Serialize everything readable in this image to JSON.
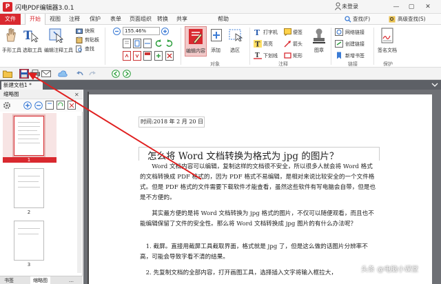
{
  "titlebar": {
    "app_title": "闪电PDF编辑器3.0.1",
    "login": "未登录",
    "logo": "P",
    "min": "—",
    "max": "▢",
    "close": "✕"
  },
  "menu": {
    "items": [
      "文件",
      "开始",
      "视图",
      "注释",
      "保护",
      "表单",
      "页面组织",
      "转换",
      "共享",
      "帮助"
    ],
    "search_left": "查找(F)",
    "search_right": "高级查找(S)"
  },
  "ribbon": {
    "hand_tool": "手形工具",
    "select_tool": "选取工具",
    "edit_annot_tool": "编辑注释工具",
    "snapshot": "快照",
    "clipboard": "剪贴板",
    "find": "查找",
    "zoom_value": "155.46%",
    "edit_content": "编辑内容",
    "add": "添加",
    "select_area": "选区",
    "group_object": "对象",
    "typewriter": "打字机",
    "highlight": "高亮",
    "underline": "下划线",
    "note": "便签",
    "arrow": "箭头",
    "rectangle": "矩形",
    "group_annot": "注释",
    "stamp": "图章",
    "web_link": "网络链接",
    "create_link": "创建链接",
    "new_bookmark": "新增书签",
    "group_link": "链接",
    "sign_doc": "签名文档",
    "group_protect": "保护"
  },
  "tabbar": {
    "doc_tab": "新建文档1 *"
  },
  "thumbs": {
    "header": "缩略图",
    "pages": [
      "1",
      "2",
      "3"
    ]
  },
  "bottom_tabs": [
    "书签",
    "缩略图",
    "…"
  ],
  "doc": {
    "time": "时间:2018 年 2 月 20 日",
    "heading": "怎么将 Word 文档转换为格式为 jpg 的图片？",
    "p1": "Word 文档内容可以编辑，复制这样的文档很不安全，所以很多人就会将 Word 格式的文档转换成 PDF 格式的，因为 PDF 格式不易编辑，是相对来说比较安全的一个文件格式。但是 PDF 格式的文件需要下载软件才能查看，虽然这些软件有写电脑会自带，但是也是不方便的。",
    "p2": "其实最方便的是将 Word 文档转换为 jpg 格式的图片，不仅可以随便观看，而且也不能编辑保留了文件的安全性。那么将 Word 文档转换成 jpg 图片的有什么办法呢？",
    "li1": "1.  截屏。直接用截屏工具截取界面，格式就是 jpg 了，但是这么做的话图片分辨率不高，可能会导致字看不清的结果。",
    "li2": "2.  先复制文档的全部内容，打开画图工具，选择插入文字将输入框拉大，"
  },
  "watermark": "头条 @电脑小课堂",
  "colors": {
    "accent": "#d9292f",
    "doc_bg": "#6e7075",
    "arrow": "#e02020"
  }
}
